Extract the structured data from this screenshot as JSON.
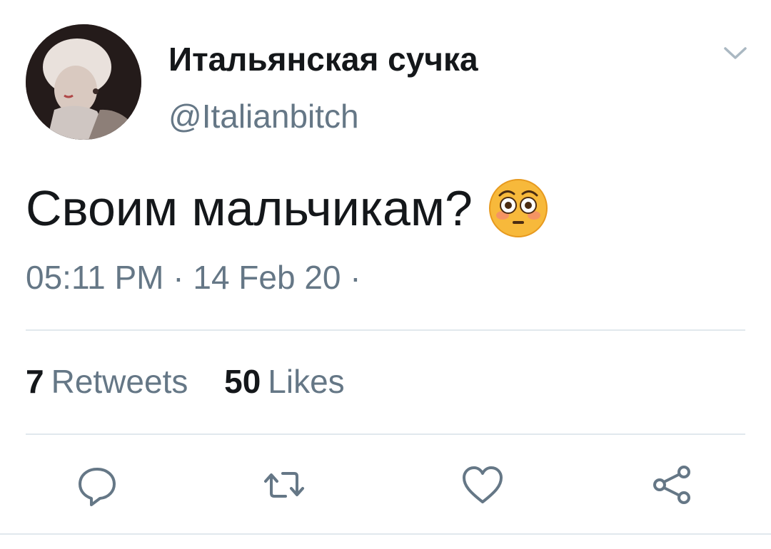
{
  "tweet": {
    "display_name": "Итальянская сучка",
    "handle": "@Italianbitch",
    "text": "Своим мальчикам?",
    "emoji": "flushed-face",
    "timestamp": "05:11 PM · 14 Feb 20 ·"
  },
  "stats": {
    "retweets_count": "7",
    "retweets_label": "Retweets",
    "likes_count": "50",
    "likes_label": "Likes"
  },
  "actions": [
    "reply",
    "retweet",
    "like",
    "share"
  ],
  "colors": {
    "text": "#14171a",
    "secondary": "#657786",
    "divider": "#e1e8ed"
  }
}
